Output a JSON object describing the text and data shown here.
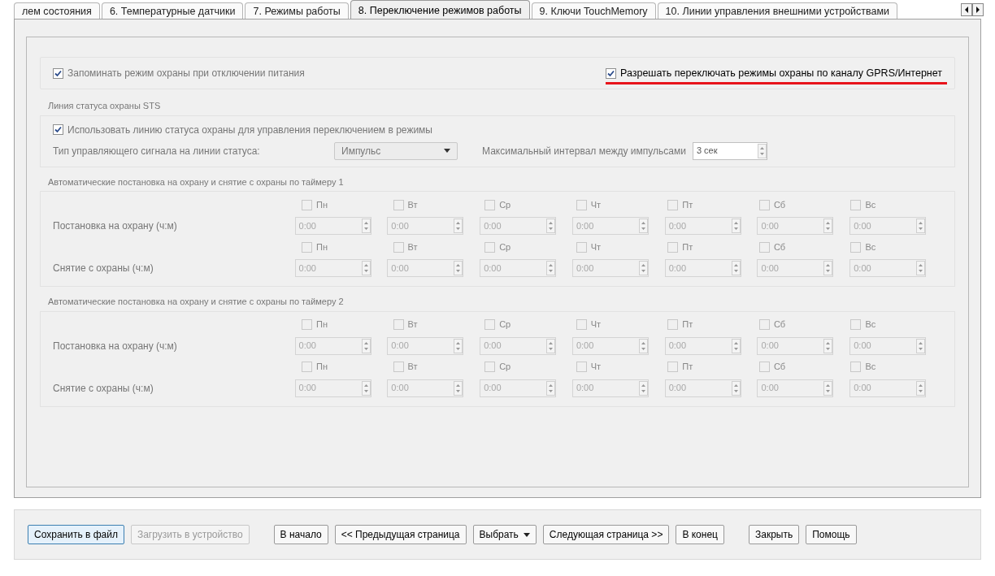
{
  "tabs": [
    {
      "label": "лем состояния",
      "selected": false
    },
    {
      "label": "6. Температурные датчики",
      "selected": false
    },
    {
      "label": "7. Режимы работы",
      "selected": false
    },
    {
      "label": "8. Переключение режимов работы",
      "selected": true
    },
    {
      "label": "9. Ключи TouchMemory",
      "selected": false
    },
    {
      "label": "10. Линии управления внешними устройствами",
      "selected": false
    }
  ],
  "top_options": [
    {
      "label": "Запоминать режим охраны при отключении питания",
      "checked": true,
      "highlighted": false
    },
    {
      "label": "Разрешать переключать режимы охраны по каналу GPRS/Интернет",
      "checked": true,
      "highlighted": true
    }
  ],
  "sts": {
    "title": "Линия статуса охраны STS",
    "use_line": {
      "label": "Использовать линию статуса охраны для управления переключением в режимы",
      "checked": true
    },
    "signal_label": "Тип управляющего сигнала на линии статуса:",
    "signal_value": "Импульс",
    "interval_label": "Максимальный интервал между импульсами",
    "interval_value": "3 сек"
  },
  "timers": [
    {
      "title": "Автоматические постановка на охрану и снятие с охраны по таймеру 1",
      "rows": [
        {
          "label": "Постановка на охрану (ч:м)",
          "days": [
            {
              "label": "Пн",
              "checked": false
            },
            {
              "label": "Вт",
              "checked": false
            },
            {
              "label": "Ср",
              "checked": false
            },
            {
              "label": "Чт",
              "checked": false
            },
            {
              "label": "Пт",
              "checked": false
            },
            {
              "label": "Сб",
              "checked": false
            },
            {
              "label": "Вс",
              "checked": false
            }
          ],
          "times": [
            "0:00",
            "0:00",
            "0:00",
            "0:00",
            "0:00",
            "0:00",
            "0:00"
          ]
        },
        {
          "label": "Снятие с охраны (ч:м)",
          "days": [
            {
              "label": "Пн",
              "checked": false
            },
            {
              "label": "Вт",
              "checked": false
            },
            {
              "label": "Ср",
              "checked": false
            },
            {
              "label": "Чт",
              "checked": false
            },
            {
              "label": "Пт",
              "checked": false
            },
            {
              "label": "Сб",
              "checked": false
            },
            {
              "label": "Вс",
              "checked": false
            }
          ],
          "times": [
            "0:00",
            "0:00",
            "0:00",
            "0:00",
            "0:00",
            "0:00",
            "0:00"
          ]
        }
      ]
    },
    {
      "title": "Автоматические постановка на охрану и снятие с охраны по таймеру 2",
      "rows": [
        {
          "label": "Постановка на охрану (ч:м)",
          "days": [
            {
              "label": "Пн",
              "checked": false
            },
            {
              "label": "Вт",
              "checked": false
            },
            {
              "label": "Ср",
              "checked": false
            },
            {
              "label": "Чт",
              "checked": false
            },
            {
              "label": "Пт",
              "checked": false
            },
            {
              "label": "Сб",
              "checked": false
            },
            {
              "label": "Вс",
              "checked": false
            }
          ],
          "times": [
            "0:00",
            "0:00",
            "0:00",
            "0:00",
            "0:00",
            "0:00",
            "0:00"
          ]
        },
        {
          "label": "Снятие с охраны (ч:м)",
          "days": [
            {
              "label": "Пн",
              "checked": false
            },
            {
              "label": "Вт",
              "checked": false
            },
            {
              "label": "Ср",
              "checked": false
            },
            {
              "label": "Чт",
              "checked": false
            },
            {
              "label": "Пт",
              "checked": false
            },
            {
              "label": "Сб",
              "checked": false
            },
            {
              "label": "Вс",
              "checked": false
            }
          ],
          "times": [
            "0:00",
            "0:00",
            "0:00",
            "0:00",
            "0:00",
            "0:00",
            "0:00"
          ]
        }
      ]
    }
  ],
  "button_groups": [
    {
      "buttons": [
        {
          "label": "Сохранить в файл",
          "focused": true,
          "disabled": false,
          "kind": "plain"
        },
        {
          "label": "Загрузить в устройство",
          "focused": false,
          "disabled": true,
          "kind": "plain"
        }
      ]
    },
    {
      "buttons": [
        {
          "label": "В начало",
          "focused": false,
          "disabled": false,
          "kind": "plain"
        },
        {
          "label": "<< Предыдущая страница",
          "focused": false,
          "disabled": false,
          "kind": "plain"
        },
        {
          "label": "Выбрать",
          "focused": false,
          "disabled": false,
          "kind": "dropdown"
        },
        {
          "label": "Следующая страница >>",
          "focused": false,
          "disabled": false,
          "kind": "plain"
        },
        {
          "label": "В конец",
          "focused": false,
          "disabled": false,
          "kind": "plain"
        }
      ]
    },
    {
      "buttons": [
        {
          "label": "Закрыть",
          "focused": false,
          "disabled": false,
          "kind": "plain"
        },
        {
          "label": "Помощь",
          "focused": false,
          "disabled": false,
          "kind": "plain"
        }
      ]
    }
  ]
}
